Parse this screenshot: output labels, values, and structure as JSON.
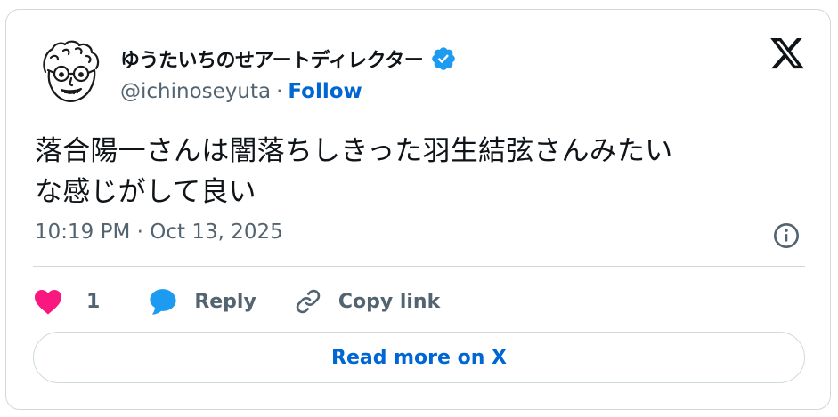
{
  "author": {
    "display_name": "ゆうたいちのせアートディレクター",
    "handle": "@ichinoseyuta",
    "separator": "·",
    "follow_label": "Follow",
    "verified_color": "#1d9bf0"
  },
  "tweet": {
    "text_line1": "落合陽一さんは闇落ちしきった羽生結弦さんみたい",
    "text_line2": "な感じがして良い",
    "timestamp": "10:19 PM · Oct 13, 2025"
  },
  "actions": {
    "like_count": "1",
    "reply_label": "Reply",
    "copy_link_label": "Copy link"
  },
  "footer": {
    "read_more_label": "Read more on X"
  },
  "colors": {
    "like": "#f91880",
    "reply": "#1d9bf0",
    "link": "#0066d3",
    "muted": "#536471",
    "border": "#cfd9de"
  },
  "icons": {
    "brand": "x-logo-icon",
    "verified": "verified-badge-icon",
    "info": "info-icon",
    "like": "heart-icon",
    "reply": "speech-bubble-icon",
    "copy": "link-icon"
  }
}
